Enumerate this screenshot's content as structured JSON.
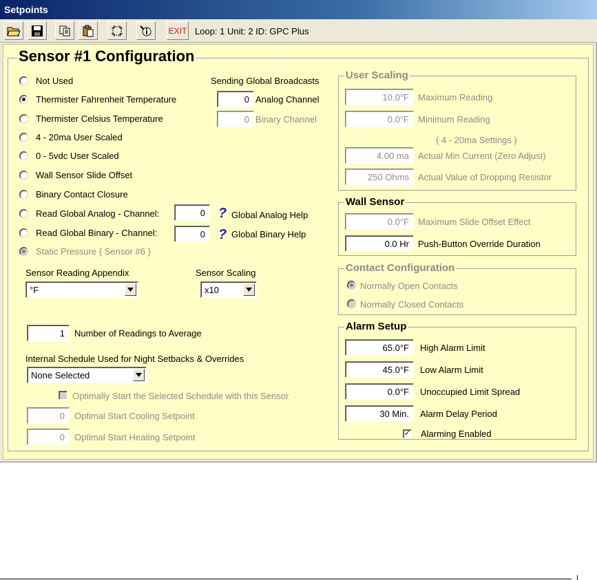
{
  "window": {
    "title": "Setpoints"
  },
  "toolbar": {
    "buttons": [
      {
        "icon": "open-folder-icon"
      },
      {
        "icon": "save-disk-icon"
      },
      {
        "icon": "copy-icon"
      },
      {
        "icon": "paste-icon"
      },
      {
        "icon": "select-frame-icon"
      },
      {
        "icon": "info-tools-icon"
      }
    ],
    "exit_label": "EXIT",
    "status": "Loop: 1   Unit: 2   ID: GPC Plus"
  },
  "main": {
    "title": "Sensor #1 Configuration",
    "sensor_types": [
      {
        "label": "Not Used",
        "checked": false,
        "disabled": false
      },
      {
        "label": "Thermister Fahrenheit Temperature",
        "checked": true,
        "disabled": false
      },
      {
        "label": "Thermister Celsius Temperature",
        "checked": false,
        "disabled": false
      },
      {
        "label": "4 - 20ma User Scaled",
        "checked": false,
        "disabled": false
      },
      {
        "label": "0 - 5vdc User Scaled",
        "checked": false,
        "disabled": false
      },
      {
        "label": "Wall Sensor Slide Offset",
        "checked": false,
        "disabled": false
      },
      {
        "label": "Binary Contact Closure",
        "checked": false,
        "disabled": false
      },
      {
        "label": "Read Global Analog  - Channel:",
        "checked": false,
        "disabled": false
      },
      {
        "label": "Read Global Binary   - Channel:",
        "checked": false,
        "disabled": false
      },
      {
        "label": "Static Pressure { Sensor #6 }",
        "checked": true,
        "disabled": true
      }
    ],
    "global_analog_channel": "0",
    "global_binary_channel": "0",
    "global_analog_help": "Global Analog Help",
    "global_binary_help": "Global Binary Help",
    "help_glyph": "?",
    "broadcast": {
      "heading": "Sending Global Broadcasts",
      "analog_value": "0",
      "analog_label": "Analog Channel",
      "binary_value": "0",
      "binary_label": "Binary Channel"
    },
    "appendix": {
      "label": "Sensor Reading Appendix",
      "value": "°F"
    },
    "scaling": {
      "label": "Sensor Scaling",
      "value": "x10"
    },
    "readings": {
      "value": "1",
      "label": "Number of Readings to Average"
    },
    "schedule": {
      "label": "Internal Schedule Used for Night Setbacks & Overrides",
      "value": "None Selected",
      "optimal_label": "Optimally Start the Selected Schedule with this Sensor",
      "cooling_value": "0",
      "cooling_label": "Optimal Start Cooling Setpoint",
      "heating_value": "0",
      "heating_label": "Optimal Start Heating Setpoint"
    }
  },
  "user_scaling": {
    "title": "User Scaling",
    "max_value": "10.0°F",
    "max_label": "Maximum Reading",
    "min_value": "0.0°F",
    "min_label": "Minimum Reading",
    "settings_note": "( 4 - 20ma Settings )",
    "current_value": "4.00 ma",
    "current_label": "Actual Min Current (Zero Adjust)",
    "resistor_value": "250 Ohms",
    "resistor_label": "Actual Value of Dropping Resistor"
  },
  "wall_sensor": {
    "title": "Wall Sensor",
    "offset_value": "0.0°F",
    "offset_label": "Maximum Slide Offset Effect",
    "override_value": "0.0 Hr",
    "override_label": "Push-Button Override Duration"
  },
  "contact": {
    "title": "Contact Configuration",
    "open_label": "Normally Open Contacts",
    "closed_label": "Normally Closed Contacts"
  },
  "alarm": {
    "title": "Alarm Setup",
    "high_value": "65.0°F",
    "high_label": "High Alarm Limit",
    "low_value": "45.0°F",
    "low_label": "Low Alarm Limit",
    "spread_value": "0.0°F",
    "spread_label": "Unoccupied Limit Spread",
    "delay_value": "30 Min.",
    "delay_label": "Alarm Delay Period",
    "enabled_label": "Alarming Enabled",
    "check_glyph": "✓"
  }
}
